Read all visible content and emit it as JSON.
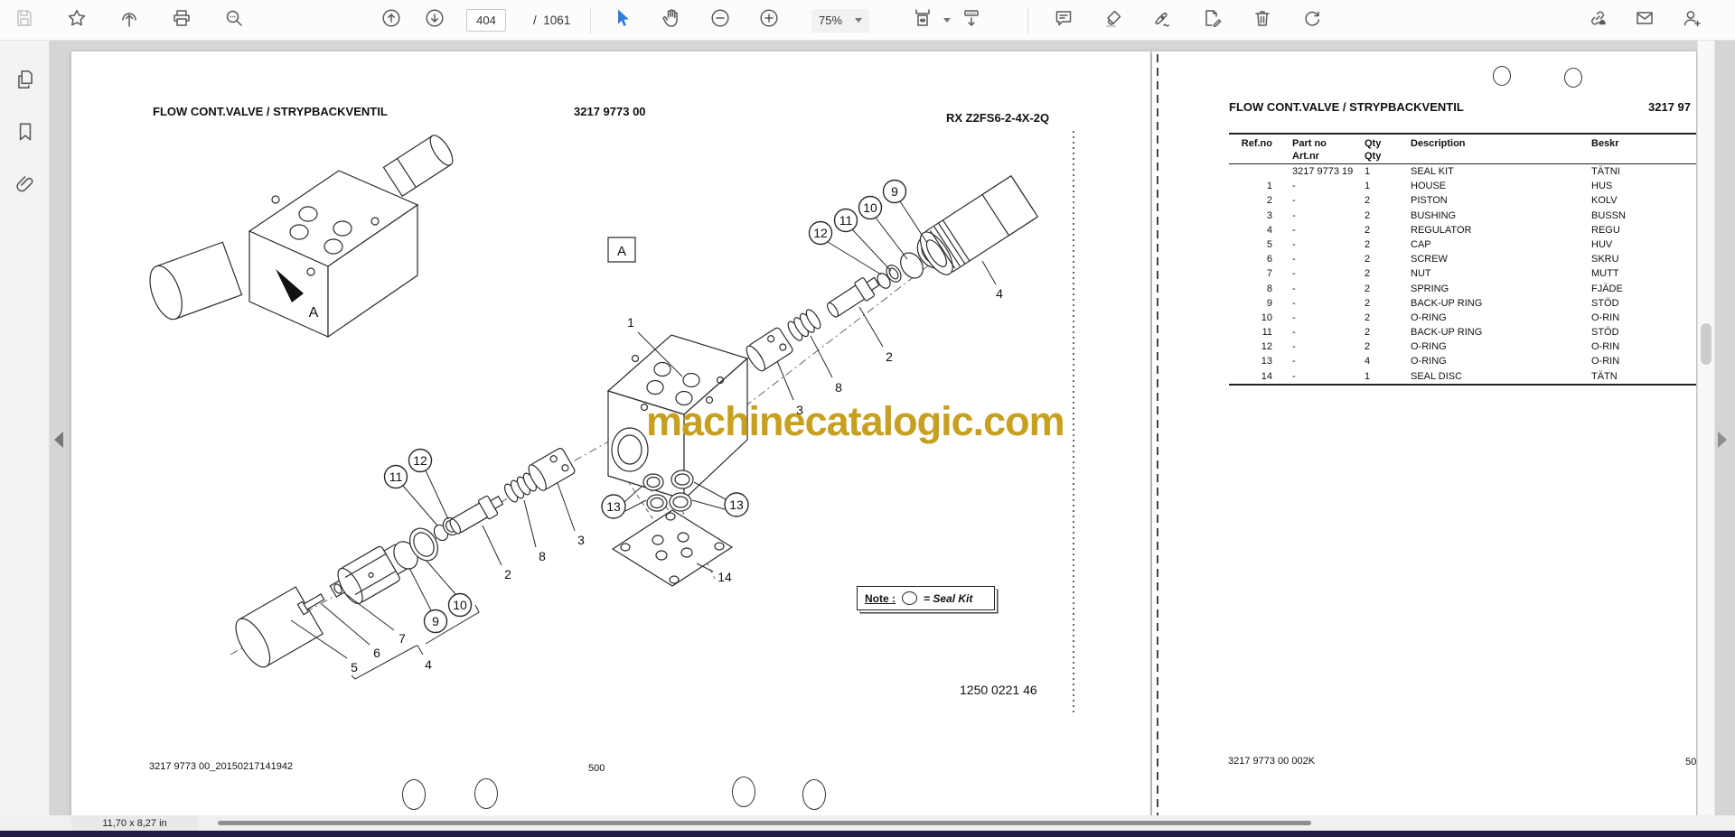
{
  "toolbar": {
    "page_current": "404",
    "page_divider": "/",
    "page_total": "1061",
    "zoom_level": "75%",
    "icons_left": [
      "save",
      "star",
      "share-upload",
      "print",
      "search"
    ],
    "icons_nav": [
      "page-up",
      "page-down"
    ],
    "icons_tools": [
      "select-cursor",
      "hand-pan",
      "zoom-out",
      "zoom-in"
    ],
    "icons_fit": [
      "fit-width",
      "continuous-scroll"
    ],
    "icons_annotate": [
      "comment",
      "highlighter",
      "signature-pen",
      "edit-page",
      "trash",
      "redo"
    ],
    "icons_right": [
      "share-link",
      "email",
      "add-user"
    ]
  },
  "sidebar": {
    "icons": [
      "page-thumbnails",
      "bookmarks",
      "attachments"
    ]
  },
  "status_bar": {
    "page_size": "11,70 x 8,27 in"
  },
  "watermark": {
    "text": "machinecatalogic.com",
    "color": "#C8A020"
  },
  "colors": {
    "accent_blue": "#2b7de0",
    "taskbar_purple": "#231b46",
    "watermark_gold": "#C8A020"
  },
  "left_page": {
    "title": "FLOW CONT.VALVE / STRYPBACKVENTIL",
    "part_number": "3217 9773 00",
    "model_code": "RX Z2FS6-2-4X-2Q",
    "figure_number": "1250 0221 46",
    "doc_id": "3217 9773 00_20150217141942",
    "page_number": "500",
    "detail_label": "A",
    "note": {
      "label": "Note :",
      "text": "= Seal Kit"
    },
    "callouts": {
      "a": "A",
      "n1": "1",
      "n2": "2",
      "n3": "3",
      "n4": "4",
      "n5": "5",
      "n6": "6",
      "n7": "7",
      "n8": "8",
      "n9": "9",
      "n10": "10",
      "n11": "11",
      "n12": "12",
      "n13": "13",
      "n14": "14"
    }
  },
  "right_page": {
    "title": "FLOW CONT.VALVE / STRYPBACKVENTIL",
    "part_number_partial": "3217 97",
    "doc_id": "3217 9773 00 002K",
    "page_number_partial": "50",
    "table": {
      "headers": {
        "ref": "Ref.no",
        "part1": "Part no",
        "part2": "Art.nr",
        "qty1": "Qty",
        "qty2": "Qty",
        "desc": "Description",
        "beskr": "Beskr"
      },
      "rows": [
        {
          "ref": "",
          "part": "3217 9773 19",
          "qty": "1",
          "desc": "SEAL KIT",
          "beskr": "TÄTNI"
        },
        {
          "ref": "1",
          "part": "-",
          "qty": "1",
          "desc": "HOUSE",
          "beskr": "HUS"
        },
        {
          "ref": "2",
          "part": "-",
          "qty": "2",
          "desc": "PISTON",
          "beskr": "KOLV"
        },
        {
          "ref": "3",
          "part": "-",
          "qty": "2",
          "desc": "BUSHING",
          "beskr": "BUSSN"
        },
        {
          "ref": "4",
          "part": "-",
          "qty": "2",
          "desc": "REGULATOR",
          "beskr": "REGU"
        },
        {
          "ref": "5",
          "part": "-",
          "qty": "2",
          "desc": "CAP",
          "beskr": "HUV"
        },
        {
          "ref": "6",
          "part": "-",
          "qty": "2",
          "desc": "SCREW",
          "beskr": "SKRU"
        },
        {
          "ref": "7",
          "part": "-",
          "qty": "2",
          "desc": "NUT",
          "beskr": "MUTT"
        },
        {
          "ref": "8",
          "part": "-",
          "qty": "2",
          "desc": "SPRING",
          "beskr": "FJÄDE"
        },
        {
          "ref": "9",
          "part": "-",
          "qty": "2",
          "desc": "BACK-UP RING",
          "beskr": "STÖD"
        },
        {
          "ref": "10",
          "part": "-",
          "qty": "2",
          "desc": "O-RING",
          "beskr": "O-RIN"
        },
        {
          "ref": "11",
          "part": "-",
          "qty": "2",
          "desc": "BACK-UP RING",
          "beskr": "STÖD"
        },
        {
          "ref": "12",
          "part": "-",
          "qty": "2",
          "desc": "O-RING",
          "beskr": "O-RIN"
        },
        {
          "ref": "13",
          "part": "-",
          "qty": "4",
          "desc": "O-RING",
          "beskr": "O-RIN"
        },
        {
          "ref": "14",
          "part": "-",
          "qty": "1",
          "desc": "SEAL DISC",
          "beskr": "TÄTN"
        }
      ]
    }
  }
}
